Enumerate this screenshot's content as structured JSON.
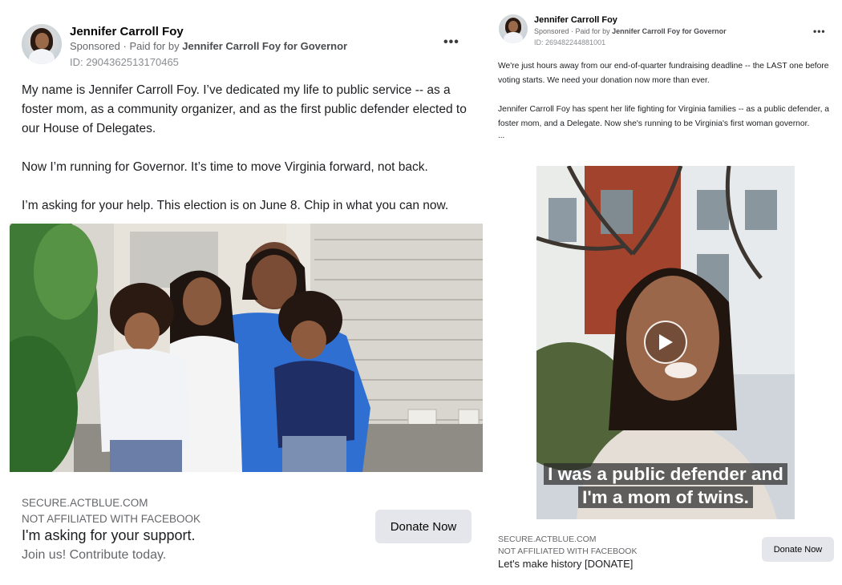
{
  "left_ad": {
    "page_name": "Jennifer Carroll Foy",
    "sponsored_label": "Sponsored",
    "paid_for_prefix": "Paid for by",
    "paid_for_by": "Jennifer Carroll Foy for Governor",
    "ad_id": "ID: 2904362513170465",
    "more_options": "•••",
    "body_paragraphs": [
      "My name is Jennifer Carroll Foy. I’ve dedicated my life to public service -- as a foster mom, as a community organizer, and as the first public defender elected to our House of Delegates.",
      "Now I’m running for Governor. It’s time to move Virginia forward, not back.",
      "I’m asking for your help. This election is on June 8. Chip in what you can now."
    ],
    "image": "family-photo-on-porch-steps",
    "link_domain": "SECURE.ACTBLUE.COM",
    "affiliation": "NOT AFFILIATED WITH FACEBOOK",
    "headline": "I'm asking for your support.",
    "description": "Join us! Contribute today.",
    "cta_label": "Donate Now"
  },
  "right_ad": {
    "page_name": "Jennifer Carroll Foy",
    "sponsored_label": "Sponsored",
    "paid_for_prefix": "Paid for by",
    "paid_for_by": "Jennifer Carroll Foy for Governor",
    "ad_id": "ID: 269482244881001",
    "more_options": "•••",
    "body_paragraphs": [
      "We're just hours away from our end-of-quarter fundraising deadline -- the LAST one before voting starts. We need your donation now more than ever.",
      "Jennifer Carroll Foy has spent her life fighting for Virginia families -- as a public defender, a foster mom, and a Delegate. Now she's running to be Virginia's first woman governor."
    ],
    "truncation": "...",
    "video": "selfie-video-outside-townhouses",
    "video_caption": "I was a public defender and I'm a mom of twins.",
    "play_icon": "play-icon",
    "link_domain": "SECURE.ACTBLUE.COM",
    "affiliation": "NOT AFFILIATED WITH FACEBOOK",
    "headline": "Let's make history [DONATE]",
    "cta_label": "Donate Now"
  }
}
